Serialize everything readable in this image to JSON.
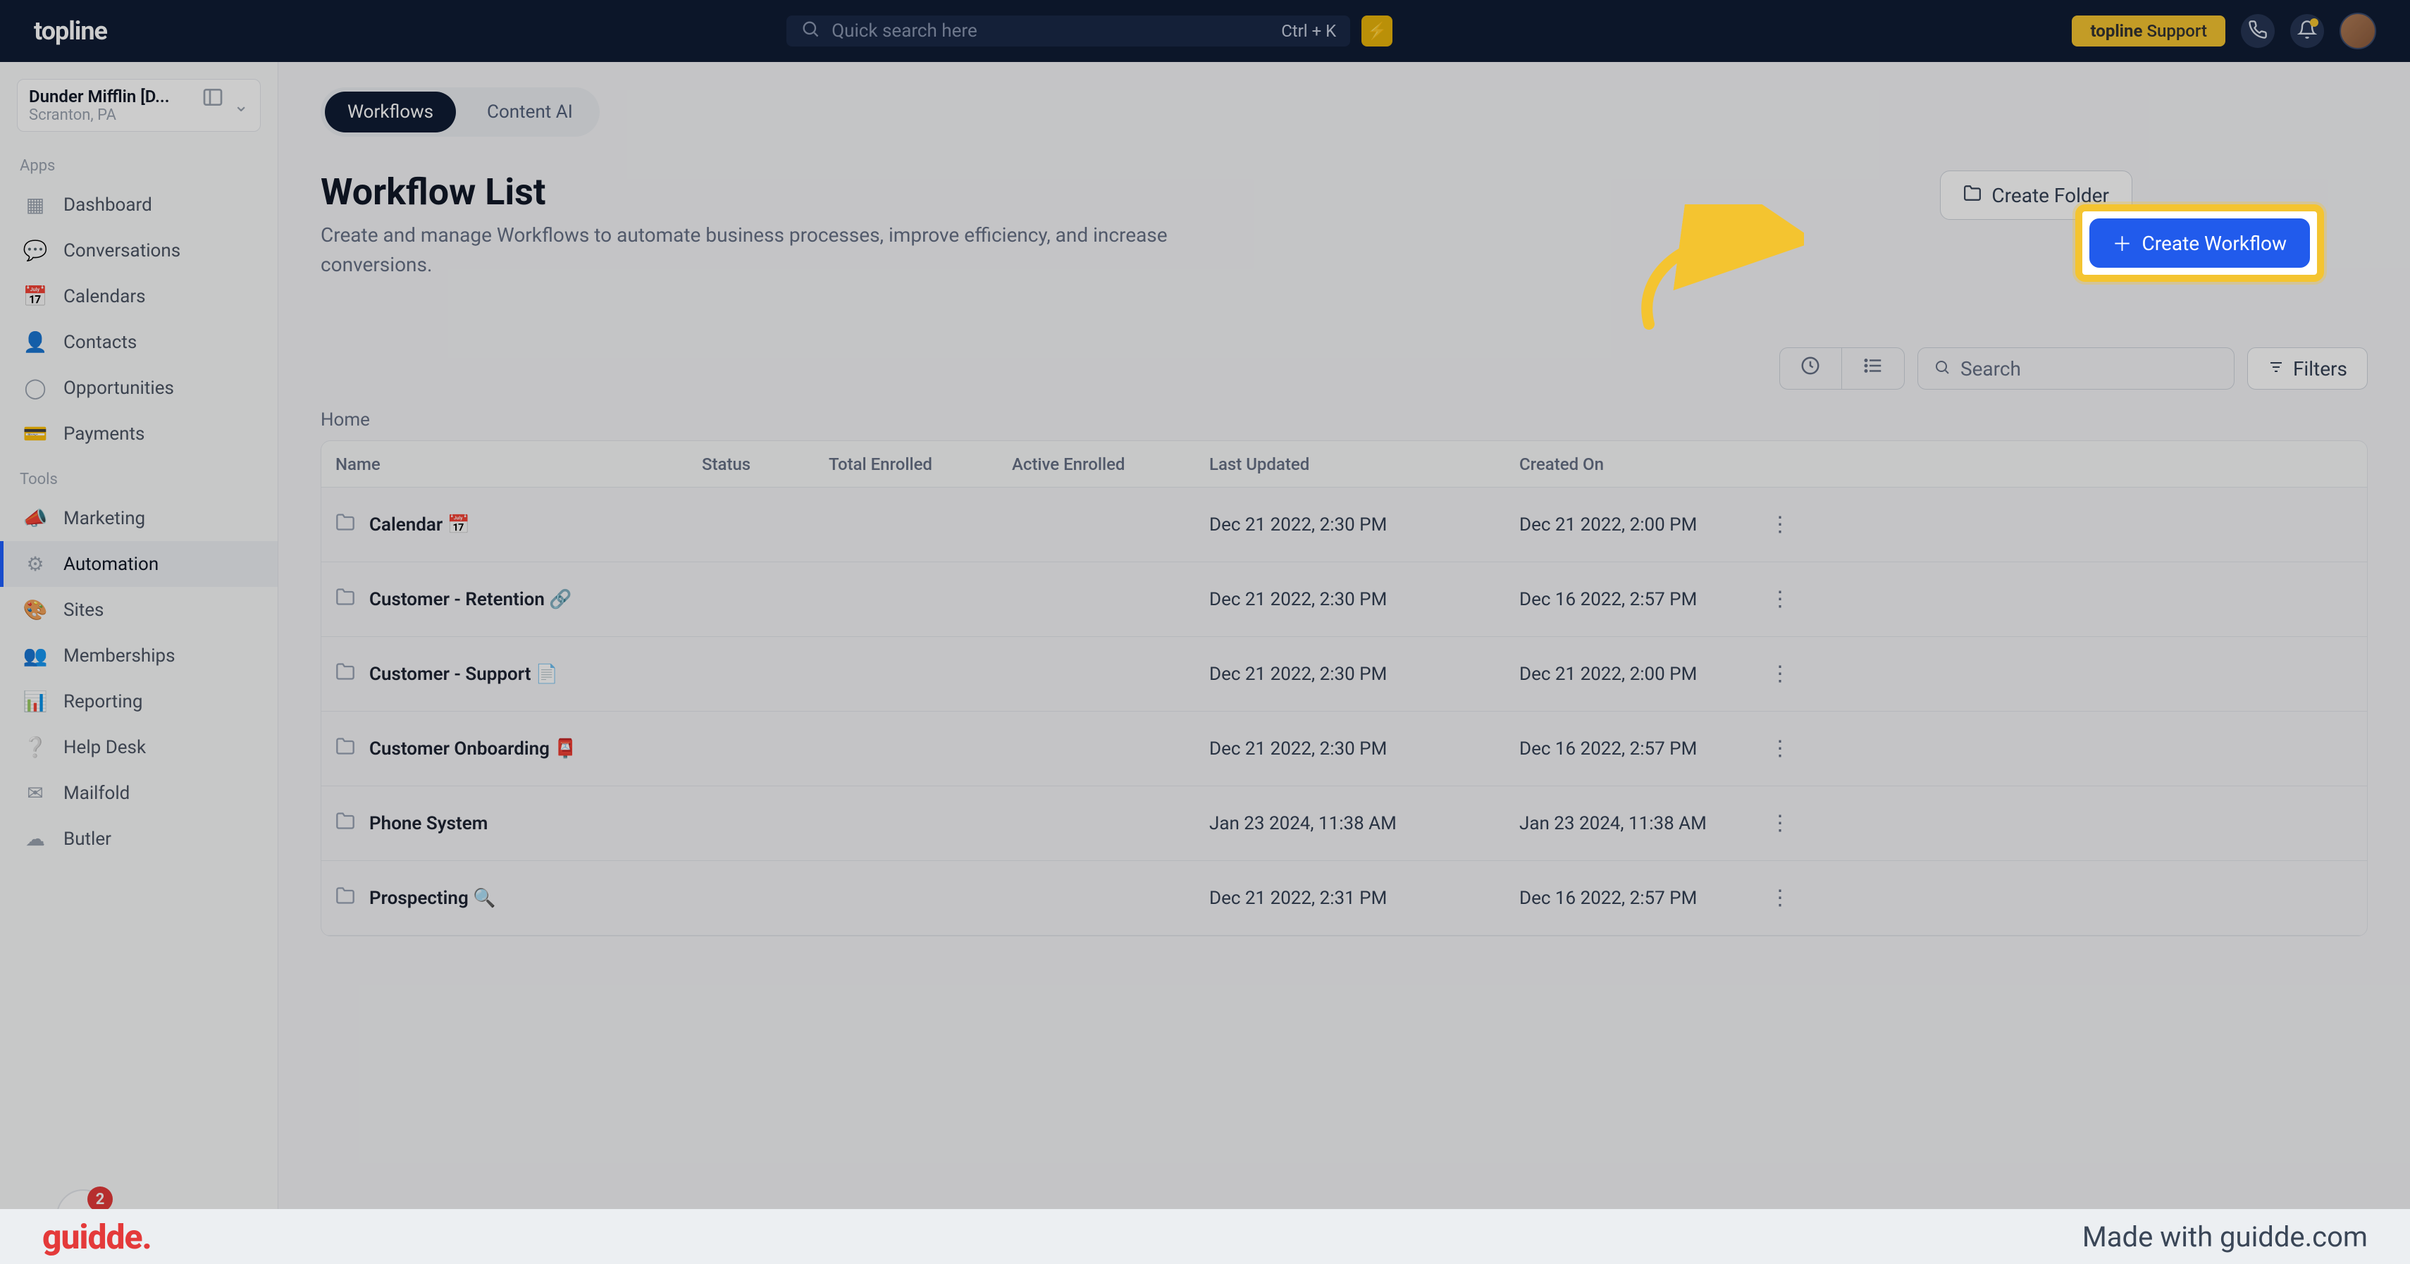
{
  "header": {
    "brand": "topline",
    "search_placeholder": "Quick search here",
    "search_kbd": "Ctrl + K",
    "support_label_bold": "topline",
    "support_label_rest": "Support"
  },
  "account": {
    "name": "Dunder Mifflin [D...",
    "location": "Scranton, PA"
  },
  "sidebar": {
    "section_apps": "Apps",
    "section_tools": "Tools",
    "apps": [
      {
        "icon": "dashboard-icon",
        "glyph": "▦",
        "label": "Dashboard"
      },
      {
        "icon": "conversations-icon",
        "glyph": "💬",
        "label": "Conversations"
      },
      {
        "icon": "calendars-icon",
        "glyph": "📅",
        "label": "Calendars"
      },
      {
        "icon": "contacts-icon",
        "glyph": "👤",
        "label": "Contacts"
      },
      {
        "icon": "opportunities-icon",
        "glyph": "◯",
        "label": "Opportunities"
      },
      {
        "icon": "payments-icon",
        "glyph": "💳",
        "label": "Payments"
      }
    ],
    "tools": [
      {
        "icon": "marketing-icon",
        "glyph": "📣",
        "label": "Marketing",
        "active": false
      },
      {
        "icon": "automation-icon",
        "glyph": "⚙",
        "label": "Automation",
        "active": true
      },
      {
        "icon": "sites-icon",
        "glyph": "🎨",
        "label": "Sites",
        "active": false
      },
      {
        "icon": "memberships-icon",
        "glyph": "👥",
        "label": "Memberships",
        "active": false
      },
      {
        "icon": "reporting-icon",
        "glyph": "📊",
        "label": "Reporting",
        "active": false
      },
      {
        "icon": "helpdesk-icon",
        "glyph": "❔",
        "label": "Help Desk",
        "active": false
      },
      {
        "icon": "mailfold-icon",
        "glyph": "✉",
        "label": "Mailfold",
        "active": false
      },
      {
        "icon": "butler-icon",
        "glyph": "☁",
        "label": "Butler",
        "active": false
      }
    ],
    "badge_count": "2"
  },
  "tabs": [
    {
      "label": "Workflows",
      "active": true
    },
    {
      "label": "Content AI",
      "active": false
    }
  ],
  "page": {
    "title": "Workflow List",
    "subtitle": "Create and manage Workflows to automate business processes, improve efficiency, and increase conversions.",
    "create_folder_label": "Create Folder",
    "create_workflow_label": "Create Workflow",
    "breadcrumb": "Home",
    "search_placeholder": "Search",
    "filters_label": "Filters"
  },
  "table": {
    "headers": {
      "name": "Name",
      "status": "Status",
      "total_enrolled": "Total Enrolled",
      "active_enrolled": "Active Enrolled",
      "last_updated": "Last Updated",
      "created_on": "Created On"
    },
    "rows": [
      {
        "name": "Calendar 📅",
        "status": "",
        "total": "",
        "active": "",
        "updated": "Dec 21 2022, 2:30 PM",
        "created": "Dec 21 2022, 2:00 PM"
      },
      {
        "name": "Customer - Retention 🔗",
        "status": "",
        "total": "",
        "active": "",
        "updated": "Dec 21 2022, 2:30 PM",
        "created": "Dec 16 2022, 2:57 PM"
      },
      {
        "name": "Customer - Support 📄",
        "status": "",
        "total": "",
        "active": "",
        "updated": "Dec 21 2022, 2:30 PM",
        "created": "Dec 21 2022, 2:00 PM"
      },
      {
        "name": "Customer Onboarding 📮",
        "status": "",
        "total": "",
        "active": "",
        "updated": "Dec 21 2022, 2:30 PM",
        "created": "Dec 16 2022, 2:57 PM"
      },
      {
        "name": "Phone System",
        "status": "",
        "total": "",
        "active": "",
        "updated": "Jan 23 2024, 11:38 AM",
        "created": "Jan 23 2024, 11:38 AM"
      },
      {
        "name": "Prospecting 🔍",
        "status": "",
        "total": "",
        "active": "",
        "updated": "Dec 21 2022, 2:31 PM",
        "created": "Dec 16 2022, 2:57 PM"
      }
    ]
  },
  "footer": {
    "logo": "guidde",
    "made_with": "Made with guidde.com"
  }
}
